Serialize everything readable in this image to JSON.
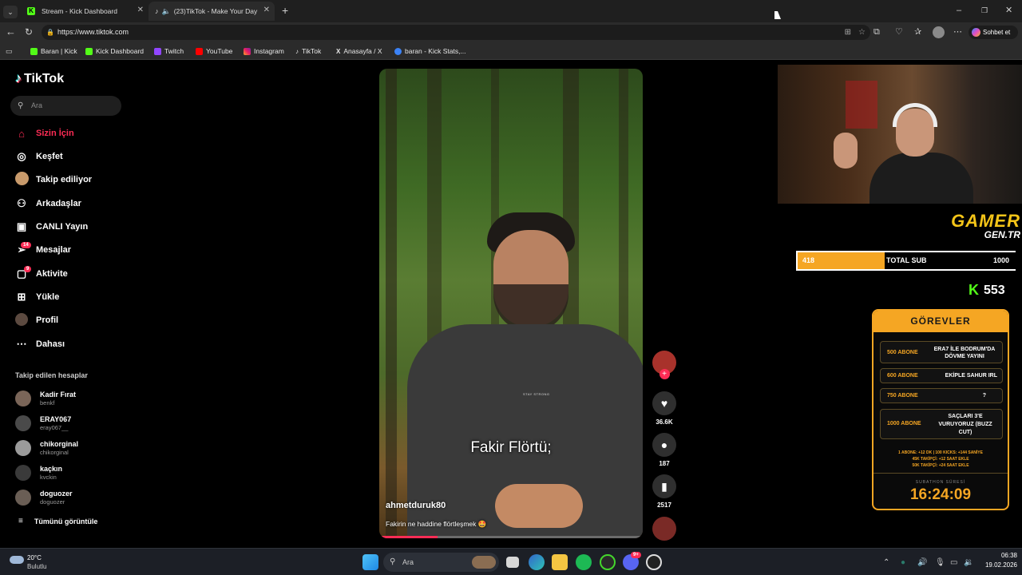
{
  "browser": {
    "tabs": [
      {
        "title": "Stream - Kick Dashboard"
      },
      {
        "title": "(23)TikTok - Make Your Day"
      }
    ],
    "url": "https://www.tiktok.com",
    "bookmarks": [
      "Baran | Kick",
      "Kick Dashboard",
      "Twitch",
      "YouTube",
      "Instagram",
      "TikTok",
      "Anasayfa / X",
      "baran - Kick Stats,..."
    ],
    "copilot_label": "Sohbet et"
  },
  "tiktok": {
    "logo": "TikTok",
    "search_placeholder": "Ara",
    "nav": [
      {
        "label": "Sizin İçin",
        "icon": "home-icon"
      },
      {
        "label": "Keşfet",
        "icon": "compass-icon"
      },
      {
        "label": "Takip ediliyor",
        "icon": "following-avatar-icon"
      },
      {
        "label": "Arkadaşlar",
        "icon": "friends-icon"
      },
      {
        "label": "CANLI Yayın",
        "icon": "live-icon"
      },
      {
        "label": "Mesajlar",
        "icon": "messages-icon",
        "badge": "14"
      },
      {
        "label": "Aktivite",
        "icon": "activity-icon",
        "badge": "9"
      },
      {
        "label": "Yükle",
        "icon": "upload-icon"
      },
      {
        "label": "Profil",
        "icon": "profile-avatar-icon"
      },
      {
        "label": "Dahası",
        "icon": "more-icon"
      }
    ],
    "following_title": "Takip edilen hesaplar",
    "following": [
      {
        "name": "Kadir Fırat",
        "handle": "benkf"
      },
      {
        "name": "ERAY067",
        "handle": "eray067__"
      },
      {
        "name": "chikorginal",
        "handle": "chikorginal"
      },
      {
        "name": "kaçkın",
        "handle": "kvckin"
      },
      {
        "name": "doguozer",
        "handle": "doguozer"
      }
    ],
    "see_all": "Tümünü görüntüle",
    "video": {
      "subtitle": "Fakir Flörtü;",
      "author": "ahmetduruk80",
      "caption": "Fakirin ne haddine flörtleşmek 🤩",
      "shirt_text": "STAY STRONG",
      "likes": "36.6K",
      "comments": "187",
      "saves": "2517",
      "progress": 0.22
    }
  },
  "overlay": {
    "brand_line1": "GAMER",
    "brand_line2": "GEN.TR",
    "sub_current": "418",
    "sub_label": "TOTAL SUB",
    "sub_goal": "1000",
    "sub_fraction": 0.418,
    "kick_count": "553",
    "tasks_title": "GÖREVLER",
    "tasks": [
      {
        "goal": "500 ABONE",
        "task": "ERA7 İLE BODRUM'DA DÖVME YAYINI"
      },
      {
        "goal": "600 ABONE",
        "task": "EKİPLE SAHUR IRL"
      },
      {
        "goal": "750 ABONE",
        "task": "?"
      },
      {
        "goal": "1000 ABONE",
        "task": "SAÇLARI 3'E VURUYORUZ (BUZZ CUT)"
      }
    ],
    "rules": [
      "1 ABONE: +12 DK | 100 KICKS: +144 SANİYE",
      "45K TAKİPÇİ: +12 SAAT EKLE",
      "50K TAKİPÇİ: +24 SAAT EKLE"
    ],
    "timer_label": "SUBATHON SÜRESİ",
    "timer": "16:24:09"
  },
  "taskbar": {
    "weather_temp": "20°C",
    "weather_desc": "Bulutlu",
    "search_label": "Ara",
    "time": "06:38",
    "date": "19.02.2026",
    "discord_badge": "9+"
  }
}
